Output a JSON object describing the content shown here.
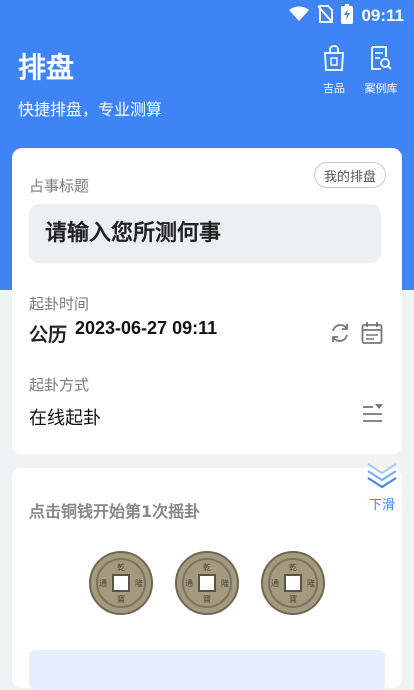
{
  "status": {
    "time": "09:11"
  },
  "header": {
    "title": "排盘",
    "subtitle": "快捷排盘，专业测算",
    "btn_jipin": "吉品",
    "btn_anliku": "案例库"
  },
  "form": {
    "subject_label": "占事标题",
    "my_charts": "我的排盘",
    "subject_placeholder": "请输入您所测何事",
    "time_label": "起卦时间",
    "calendar": "公历",
    "datetime": "2023-06-27 09:11",
    "method_label": "起卦方式",
    "method_value": "在线起卦"
  },
  "shake": {
    "instruction": "点击铜钱开始第1次摇卦",
    "slide_label": "下滑"
  },
  "colors": {
    "accent": "#3f84f6"
  }
}
